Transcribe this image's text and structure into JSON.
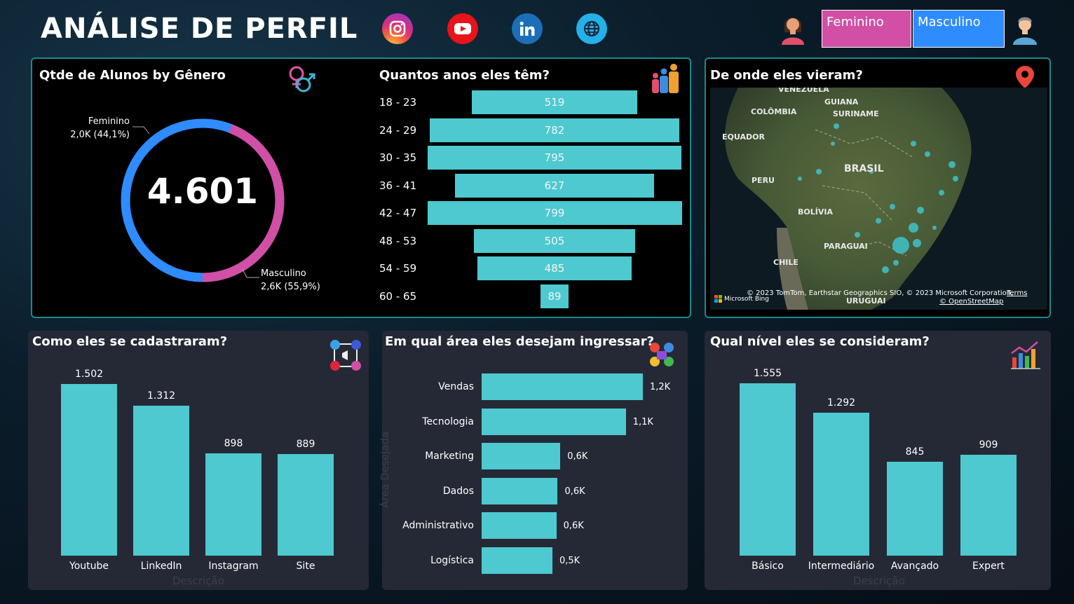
{
  "header": {
    "title": "ANÁLISE DE PERFIL",
    "social_icons": [
      "instagram-icon",
      "youtube-icon",
      "linkedin-icon",
      "globe-icon"
    ],
    "slicer": {
      "option_1": "Feminino",
      "option_2": "Masculino"
    }
  },
  "colors": {
    "accent_teal": "#4ec9cf",
    "female_pink": "#d14fa5",
    "male_blue": "#2f8cff",
    "panel_border": "#1a8a8c",
    "panel_grey": "#252936"
  },
  "gender_panel": {
    "title": "Qtde de Alunos by Gênero",
    "total": "4.601",
    "female_label": "Feminino",
    "female_value": "2,0K (44,1%)",
    "male_label": "Masculino",
    "male_value": "2,6K (55,9%)"
  },
  "age_panel": {
    "title": "Quantos anos eles têm?",
    "rows": [
      {
        "range": "18 - 23",
        "value": "519"
      },
      {
        "range": "24 - 29",
        "value": "782"
      },
      {
        "range": "30 - 35",
        "value": "795"
      },
      {
        "range": "36 - 41",
        "value": "627"
      },
      {
        "range": "42 - 47",
        "value": "799"
      },
      {
        "range": "48 - 53",
        "value": "505"
      },
      {
        "range": "54 - 59",
        "value": "485"
      },
      {
        "range": "60 - 65",
        "value": "89"
      }
    ]
  },
  "map_panel": {
    "title": "De onde eles vieram?",
    "labels": [
      "VENEZUELA",
      "GUIANA",
      "COLÔMBIA",
      "SURINAME",
      "EQUADOR",
      "BRASIL",
      "PERU",
      "BOLÍVIA",
      "PARAGUAI",
      "CHILE",
      "URUGUAI"
    ],
    "bing": "Microsoft Bing",
    "copyright": "© 2023 TomTom, Earthstar Geographics SIO, © 2023 Microsoft Corporation,",
    "terms": "Terms",
    "osm": "© OpenStreetMap"
  },
  "signup_panel": {
    "title": "Como eles se cadastraram?",
    "axis_ghost": "Descrição",
    "bars": [
      {
        "label": "Youtube",
        "value": "1.502"
      },
      {
        "label": "LinkedIn",
        "value": "1.312"
      },
      {
        "label": "Instagram",
        "value": "898"
      },
      {
        "label": "Site",
        "value": "889"
      }
    ]
  },
  "area_panel": {
    "title": "Em qual área eles desejam ingressar?",
    "axis_ghost": "Área Desejada",
    "bars": [
      {
        "label": "Vendas",
        "value": "1,2K"
      },
      {
        "label": "Tecnologia",
        "value": "1,1K"
      },
      {
        "label": "Marketing",
        "value": "0,6K"
      },
      {
        "label": "Dados",
        "value": "0,6K"
      },
      {
        "label": "Administrativo",
        "value": "0,6K"
      },
      {
        "label": "Logística",
        "value": "0,5K"
      }
    ]
  },
  "level_panel": {
    "title": "Qual nível eles se consideram?",
    "axis_ghost": "Descrição",
    "bars": [
      {
        "label": "Básico",
        "value": "1.555"
      },
      {
        "label": "Intermediário",
        "value": "1.292"
      },
      {
        "label": "Avançado",
        "value": "845"
      },
      {
        "label": "Expert",
        "value": "909"
      }
    ]
  }
}
